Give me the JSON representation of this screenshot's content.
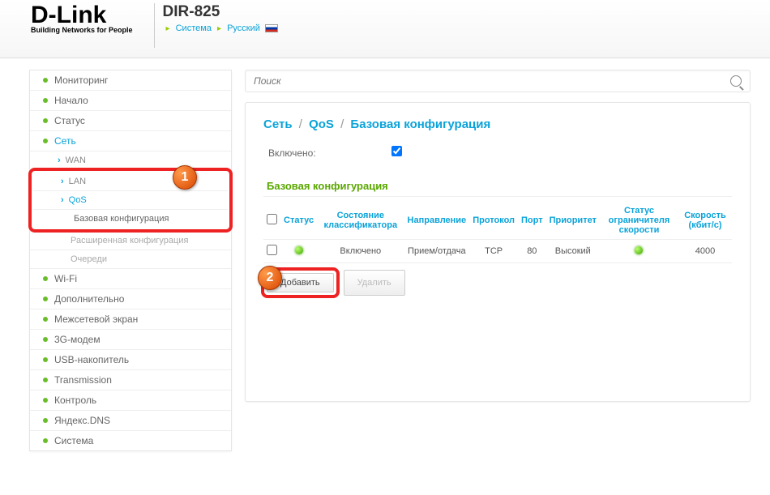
{
  "header": {
    "logo": "D-Link",
    "logo_sub": "Building Networks for People",
    "model": "DIR-825",
    "crumb_system": "Система",
    "crumb_lang": "Русский"
  },
  "search": {
    "placeholder": "Поиск"
  },
  "sidebar": {
    "items": [
      "Мониторинг",
      "Начало",
      "Статус",
      "Сеть"
    ],
    "net_sub": [
      "WAN",
      "LAN",
      "QoS"
    ],
    "qos_sub": [
      "Базовая конфигурация",
      "Расширенная конфигурация",
      "Очереди"
    ],
    "items_after": [
      "Wi-Fi",
      "Дополнительно",
      "Межсетевой экран",
      "3G-модем",
      "USB-накопитель",
      "Transmission",
      "Контроль",
      "Яндекс.DNS",
      "Система"
    ]
  },
  "content": {
    "bc1": "Сеть",
    "bc2": "QoS",
    "bc3": "Базовая конфигурация",
    "enabled_label": "Включено:",
    "section": "Базовая конфигурация",
    "cols": {
      "status": "Статус",
      "class_state": "Состояние классификатора",
      "direction": "Направление",
      "protocol": "Протокол",
      "port": "Порт",
      "priority": "Приоритет",
      "limiter": "Статус ограничителя скорости",
      "speed": "Скорость (кбит/с)"
    },
    "row": {
      "class_state": "Включено",
      "direction": "Прием/отдача",
      "protocol": "TCP",
      "port": "80",
      "priority": "Высокий",
      "speed": "4000"
    },
    "btn_add": "Добавить",
    "btn_del": "Удалить"
  },
  "badges": {
    "one": "1",
    "two": "2"
  }
}
